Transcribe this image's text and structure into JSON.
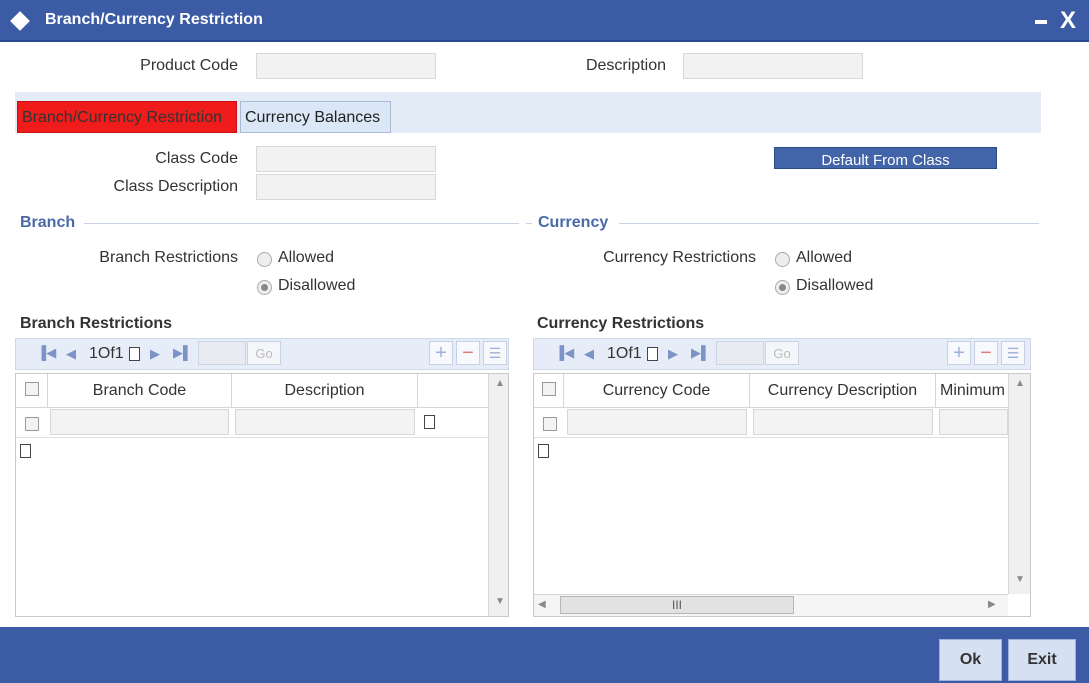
{
  "window": {
    "title": "Branch/Currency Restriction",
    "minimize_label": "_",
    "close_label": "X"
  },
  "header": {
    "product_code_label": "Product Code",
    "product_code_value": "",
    "description_label": "Description",
    "description_value": ""
  },
  "tabs": [
    {
      "label": "Branch/Currency Restriction",
      "active": true
    },
    {
      "label": "Currency Balances",
      "active": false
    }
  ],
  "class_section": {
    "class_code_label": "Class Code",
    "class_code_value": "",
    "class_description_label": "Class Description",
    "class_description_value": "",
    "default_button_label": "Default From Class"
  },
  "branch": {
    "section_title": "Branch",
    "restrictions_label": "Branch Restrictions",
    "options": [
      {
        "label": "Allowed",
        "checked": false
      },
      {
        "label": "Disallowed",
        "checked": true
      }
    ]
  },
  "currency": {
    "section_title": "Currency",
    "restrictions_label": "Currency Restrictions",
    "options": [
      {
        "label": "Allowed",
        "checked": false
      },
      {
        "label": "Disallowed",
        "checked": true
      }
    ]
  },
  "branch_grid": {
    "title": "Branch Restrictions",
    "pager_text": "1Of1",
    "go_label": "Go",
    "columns": [
      "Branch Code",
      "Description"
    ],
    "rows": [
      {
        "branch_code": "",
        "description": ""
      }
    ]
  },
  "currency_grid": {
    "title": "Currency Restrictions",
    "pager_text": "1Of1",
    "go_label": "Go",
    "columns": [
      "Currency Code",
      "Currency Description",
      "Minimum"
    ],
    "rows": [
      {
        "currency_code": "",
        "currency_description": "",
        "minimum": ""
      }
    ]
  },
  "footer": {
    "ok_label": "Ok",
    "exit_label": "Exit"
  },
  "colors": {
    "title_bar": "#3b5ba5",
    "active_tab": "#f01b1b",
    "section_title": "#4a6aa8"
  }
}
